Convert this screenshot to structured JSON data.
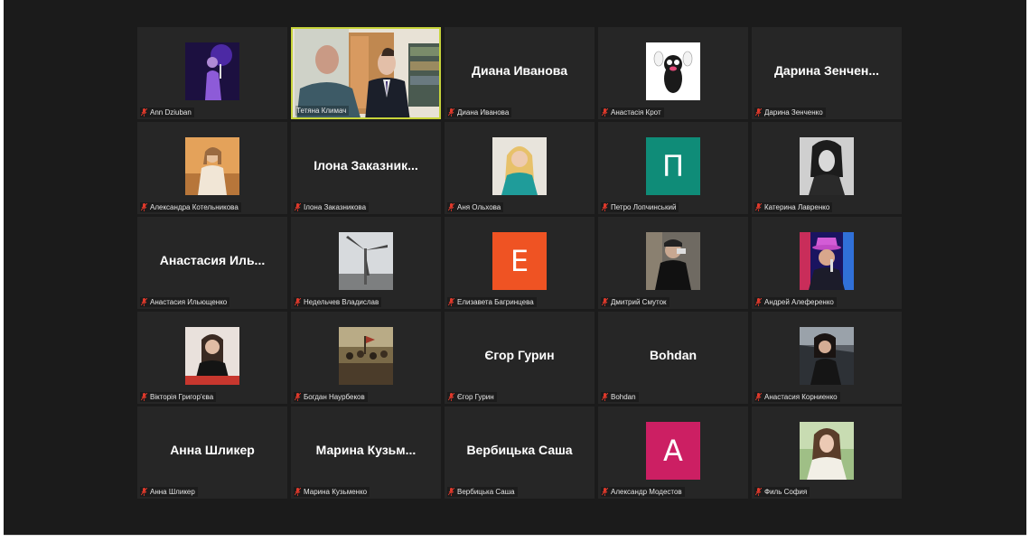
{
  "participants": [
    {
      "name": "Ann Dziuban",
      "type": "photo"
    },
    {
      "name": "Тетяна Климач",
      "type": "video",
      "active": true
    },
    {
      "name": "Диана Иванова",
      "type": "text",
      "display": "Диана Иванова"
    },
    {
      "name": "Анастасія Крот",
      "type": "photo"
    },
    {
      "name": "Дарина Зенченко",
      "type": "text",
      "display": "Дарина  Зенчен..."
    },
    {
      "name": "Александра Котельникова",
      "type": "photo"
    },
    {
      "name": "Ілона Заказникова",
      "type": "text",
      "display": "Ілона  Заказник..."
    },
    {
      "name": "Аня Ольхова",
      "type": "photo"
    },
    {
      "name": "Петро Лопчинський",
      "type": "letter",
      "letter": "П",
      "color": "#0f8c78"
    },
    {
      "name": "Катерина Лавренко",
      "type": "photo"
    },
    {
      "name": "Анастасия Ильющенко",
      "type": "text",
      "display": "Анастасия  Иль..."
    },
    {
      "name": "Недельчев Владислав",
      "type": "photo"
    },
    {
      "name": "Елизавета Багринцева",
      "type": "letter",
      "letter": "Е",
      "color": "#ef5323"
    },
    {
      "name": "Дмитрий Смуток",
      "type": "photo"
    },
    {
      "name": "Андрей Алеференко",
      "type": "photo"
    },
    {
      "name": "Вікторія Григор'єва",
      "type": "photo"
    },
    {
      "name": "Богдан Наурбеков",
      "type": "photo"
    },
    {
      "name": "Єгор Гурин",
      "type": "text",
      "display": "Єгор Гурин"
    },
    {
      "name": "Bohdan",
      "type": "text",
      "display": "Bohdan"
    },
    {
      "name": "Анастасия Корниенко",
      "type": "photo"
    },
    {
      "name": "Анна Шликер",
      "type": "text",
      "display": "Анна Шликер"
    },
    {
      "name": "Марина Кузьменко",
      "type": "text",
      "display": "Марина  Кузьм..."
    },
    {
      "name": "Вербицька Саша",
      "type": "text",
      "display": "Вербицька Саша"
    },
    {
      "name": "Александр Модестов",
      "type": "letter",
      "letter": "А",
      "color": "#cc1f63"
    },
    {
      "name": "Филь София",
      "type": "photo"
    }
  ],
  "colors": {
    "active_border": "#c7d43a",
    "mic_muted": "#e0392b",
    "tile": "#262626",
    "background": "#1b1b1b"
  }
}
